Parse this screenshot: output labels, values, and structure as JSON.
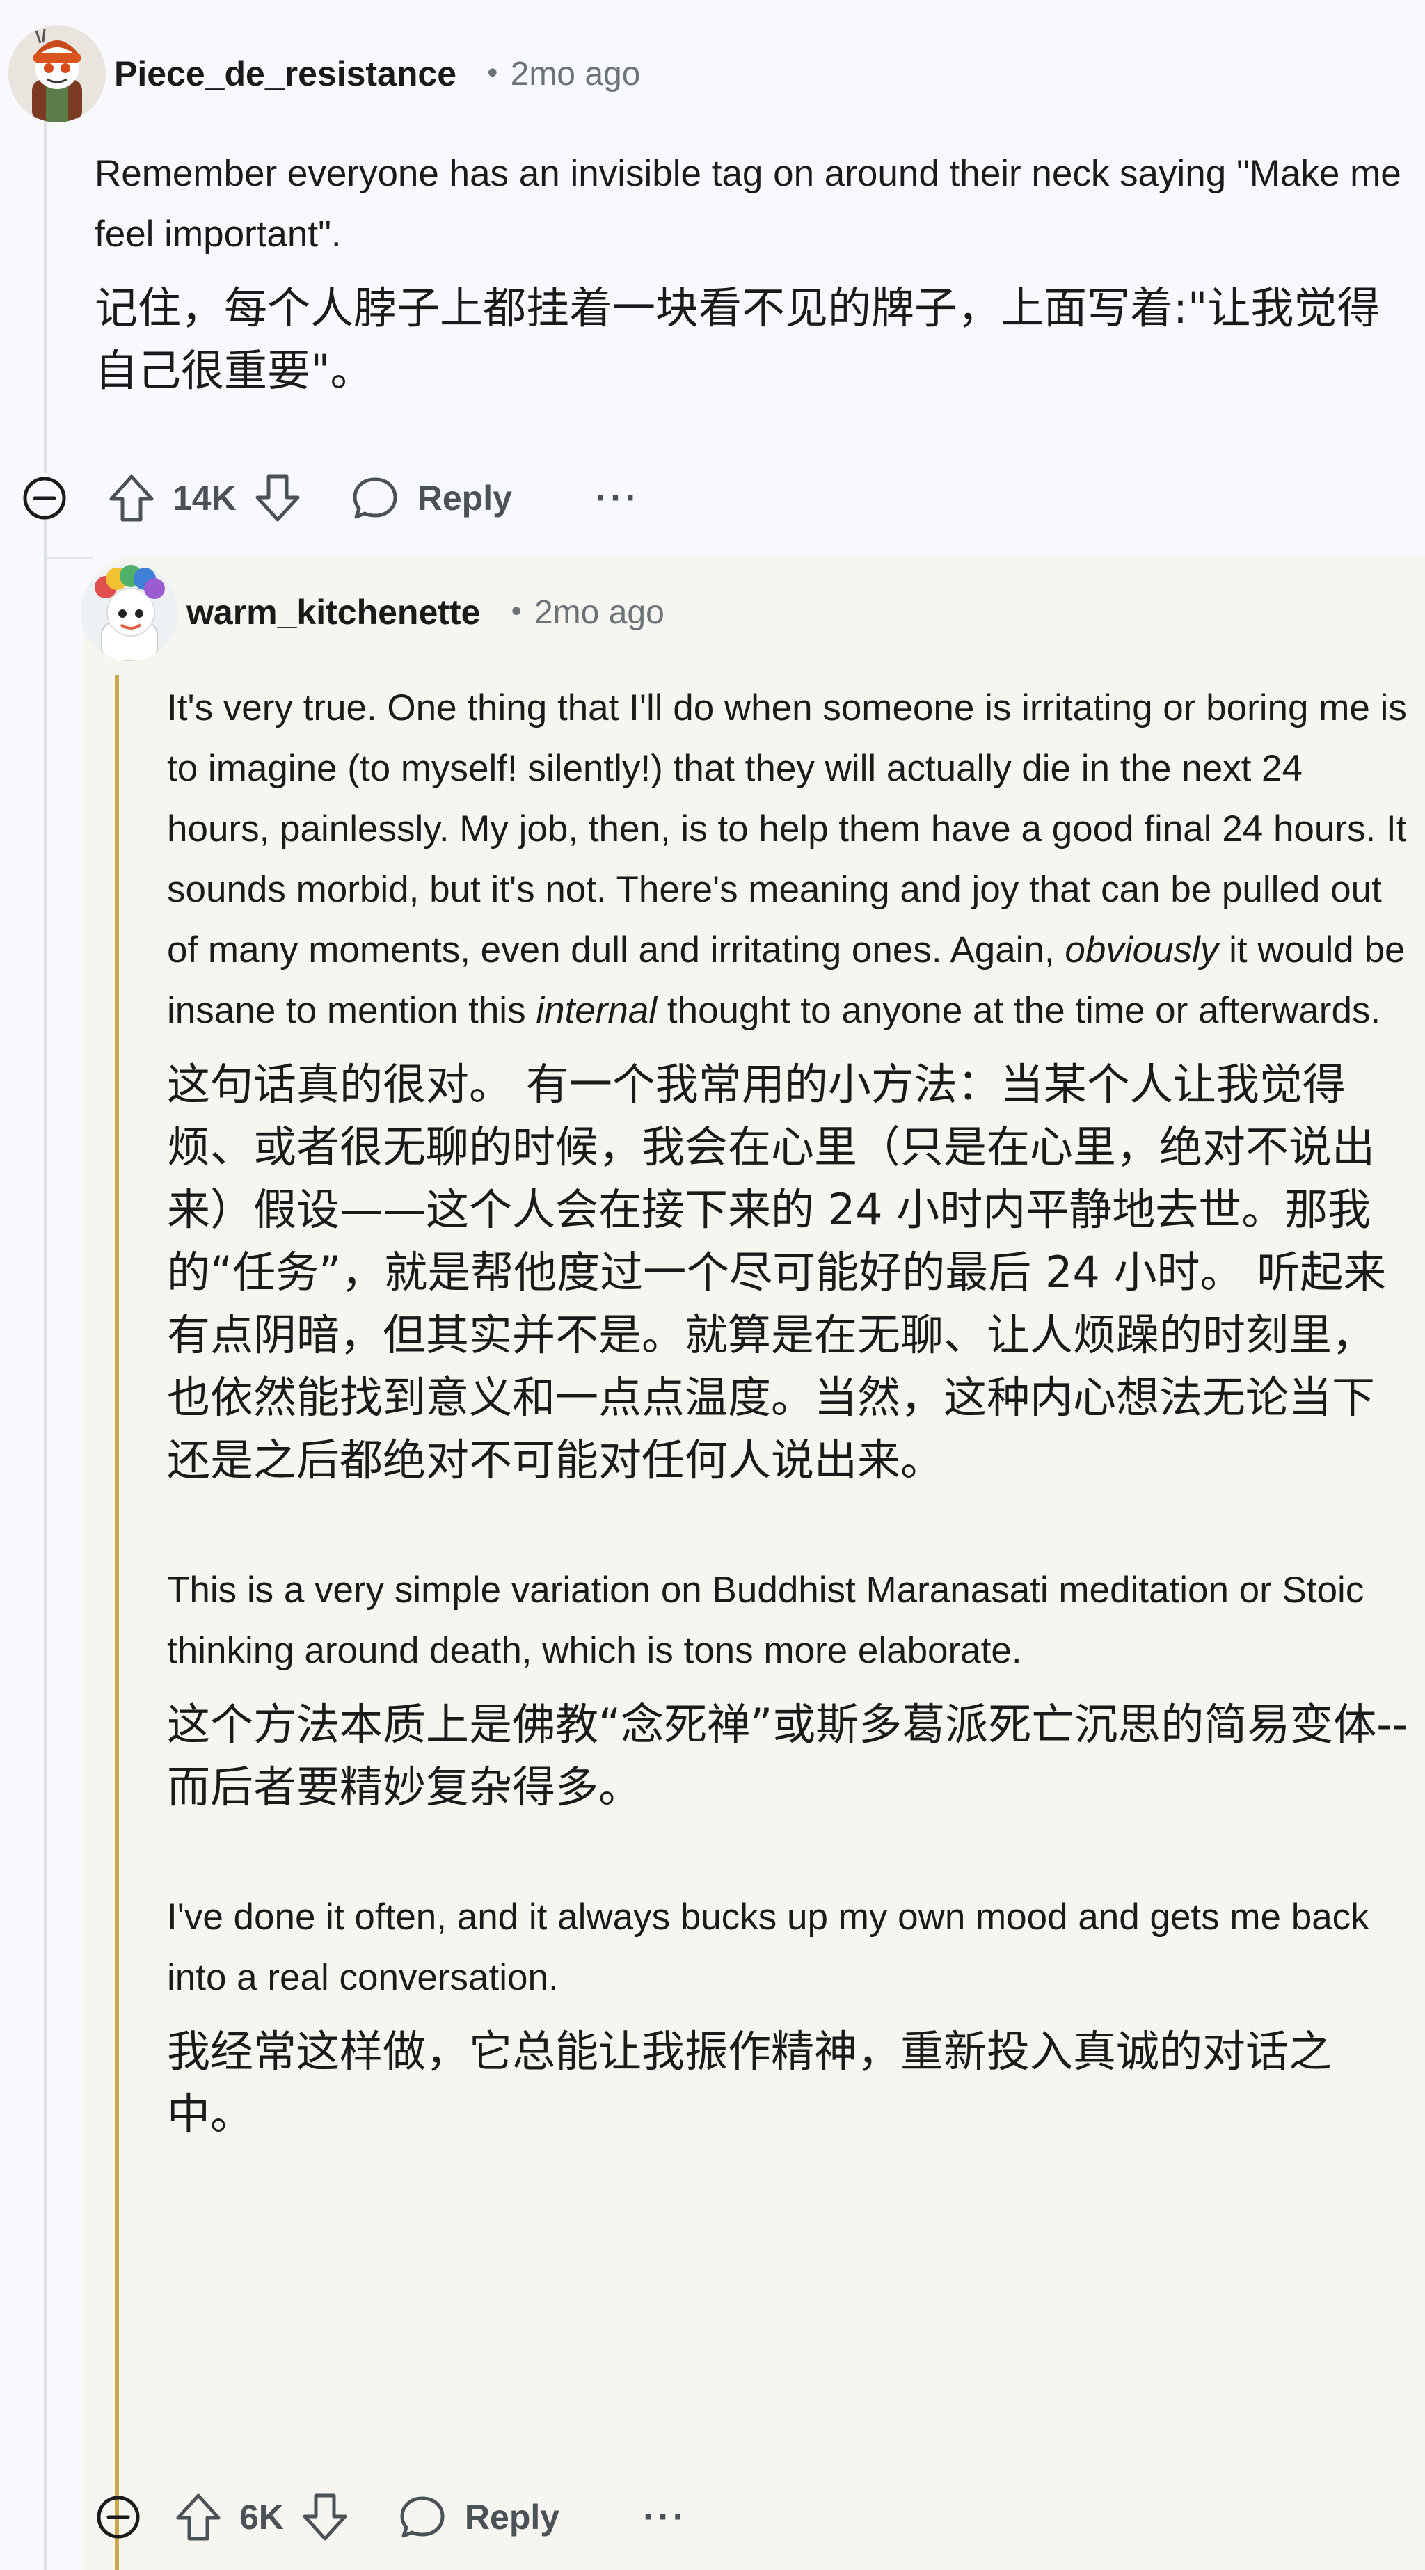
{
  "comment": {
    "username": "Piece_de_resistance",
    "separator": "•",
    "time": "2mo ago",
    "text_en": "Remember everyone has an invisible tag on around their neck saying \"Make me feel important\".",
    "text_zh": "记住，每个人脖子上都挂着一块看不见的牌子，上面写着:\"让我觉得自己很重要\"。",
    "votes": "14K",
    "reply_label": "Reply",
    "more_label": "···"
  },
  "reply": {
    "username": "warm_kitchenette",
    "separator": "•",
    "time": "2mo ago",
    "p1_en_a": "It's very true. One thing that I'll do when someone is irritating or boring me is to imagine (to myself! silently!) that they will actually die in the next 24 hours, painlessly. My job, then, is to help them have a good final 24 hours. It sounds morbid, but it's not. There's meaning and joy that can be pulled out of many moments, even dull and irritating ones. Again, ",
    "p1_en_em1": "obviously",
    "p1_en_b": " it would be insane to mention this ",
    "p1_en_em2": "internal",
    "p1_en_c": " thought to anyone at the time or afterwards.",
    "p1_zh": "这句话真的很对。 有一个我常用的小方法：当某个人让我觉得烦、或者很无聊的时候，我会在心里（只是在心里，绝对不说出来）假设——这个人会在接下来的 24 小时内平静地去世。那我的“任务”，就是帮他度过一个尽可能好的最后 24 小时。 听起来有点阴暗，但其实并不是。就算是在无聊、让人烦躁的时刻里，也依然能找到意义和一点点温度。当然，这种内心想法无论当下还是之后都绝对不可能对任何人说出来。",
    "p2_en": "This is a very simple variation on Buddhist Maranasati meditation or Stoic thinking around death, which is tons more elaborate.",
    "p2_zh": "这个方法本质上是佛教“念死禅”或斯多葛派死亡沉思的简易变体--而后者要精妙复杂得多。",
    "p3_en": "I've done it often, and it always bucks up my own mood and gets me back into a real conversation.",
    "p3_zh": "我经常这样做，它总能让我振作精神，重新投入真诚的对话之中。",
    "votes": "6K",
    "reply_label": "Reply",
    "more_label": "···"
  },
  "colors": {
    "background": "#f7f9fc",
    "reply_panel": "#f7f5f0",
    "quote_bar": "#c9a74b",
    "meta_text": "#6b7378"
  }
}
